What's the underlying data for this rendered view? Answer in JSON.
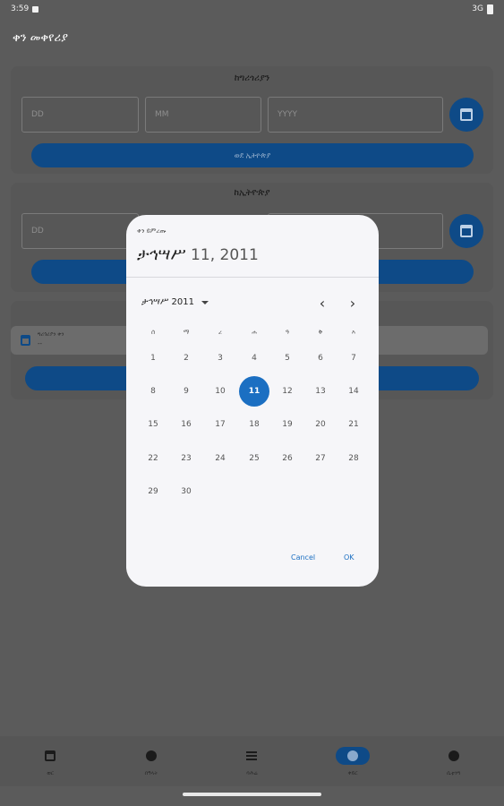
{
  "status": {
    "time": "3:59",
    "network": "3G"
  },
  "app": {
    "title": "ቀን መቀየሪያ"
  },
  "card1": {
    "title": "ከግሪጎሪያን",
    "day_placeholder": "DD",
    "month_placeholder": "MM",
    "year_placeholder": "YYYY",
    "convert_label": "ወደ ኢትዮጵያ"
  },
  "card2": {
    "title": "ከኢትዮጵያ",
    "day_placeholder": "DD"
  },
  "result": {
    "label": "ግሪጎሪያን ቀን",
    "value": "--"
  },
  "bottom_nav": [
    {
      "label": "ወር",
      "icon": "calendar-icon"
    },
    {
      "label": "በዓላት",
      "icon": "circle-icon"
    },
    {
      "label": "ባሕሬ",
      "icon": "list-icon"
    },
    {
      "label": "ቀይር",
      "icon": "convert-icon",
      "active": true
    },
    {
      "label": "ሴቲንግ",
      "icon": "settings-icon"
    }
  ],
  "dialog": {
    "header_label": "ቀን ይምረጡ",
    "selected_date_month": "ታኅሣሥ",
    "selected_date_rest": " 11, 2011",
    "month_year_label": "ታኅሣሥ 2011",
    "weekdays": [
      "ሰ",
      "ማ",
      "ረ",
      "ሐ",
      "ዓ",
      "ቅ",
      "እ"
    ],
    "days": [
      "1",
      "2",
      "3",
      "4",
      "5",
      "6",
      "7",
      "8",
      "9",
      "10",
      "11",
      "12",
      "13",
      "14",
      "15",
      "16",
      "17",
      "18",
      "19",
      "20",
      "21",
      "22",
      "23",
      "24",
      "25",
      "26",
      "27",
      "28",
      "29",
      "30"
    ],
    "selected_day": "11",
    "cancel_label": "Cancel",
    "ok_label": "OK"
  },
  "colors": {
    "accent": "#1b6fc2",
    "scrim": "#5b5b5b",
    "dialog_bg": "#f6f6f9"
  }
}
